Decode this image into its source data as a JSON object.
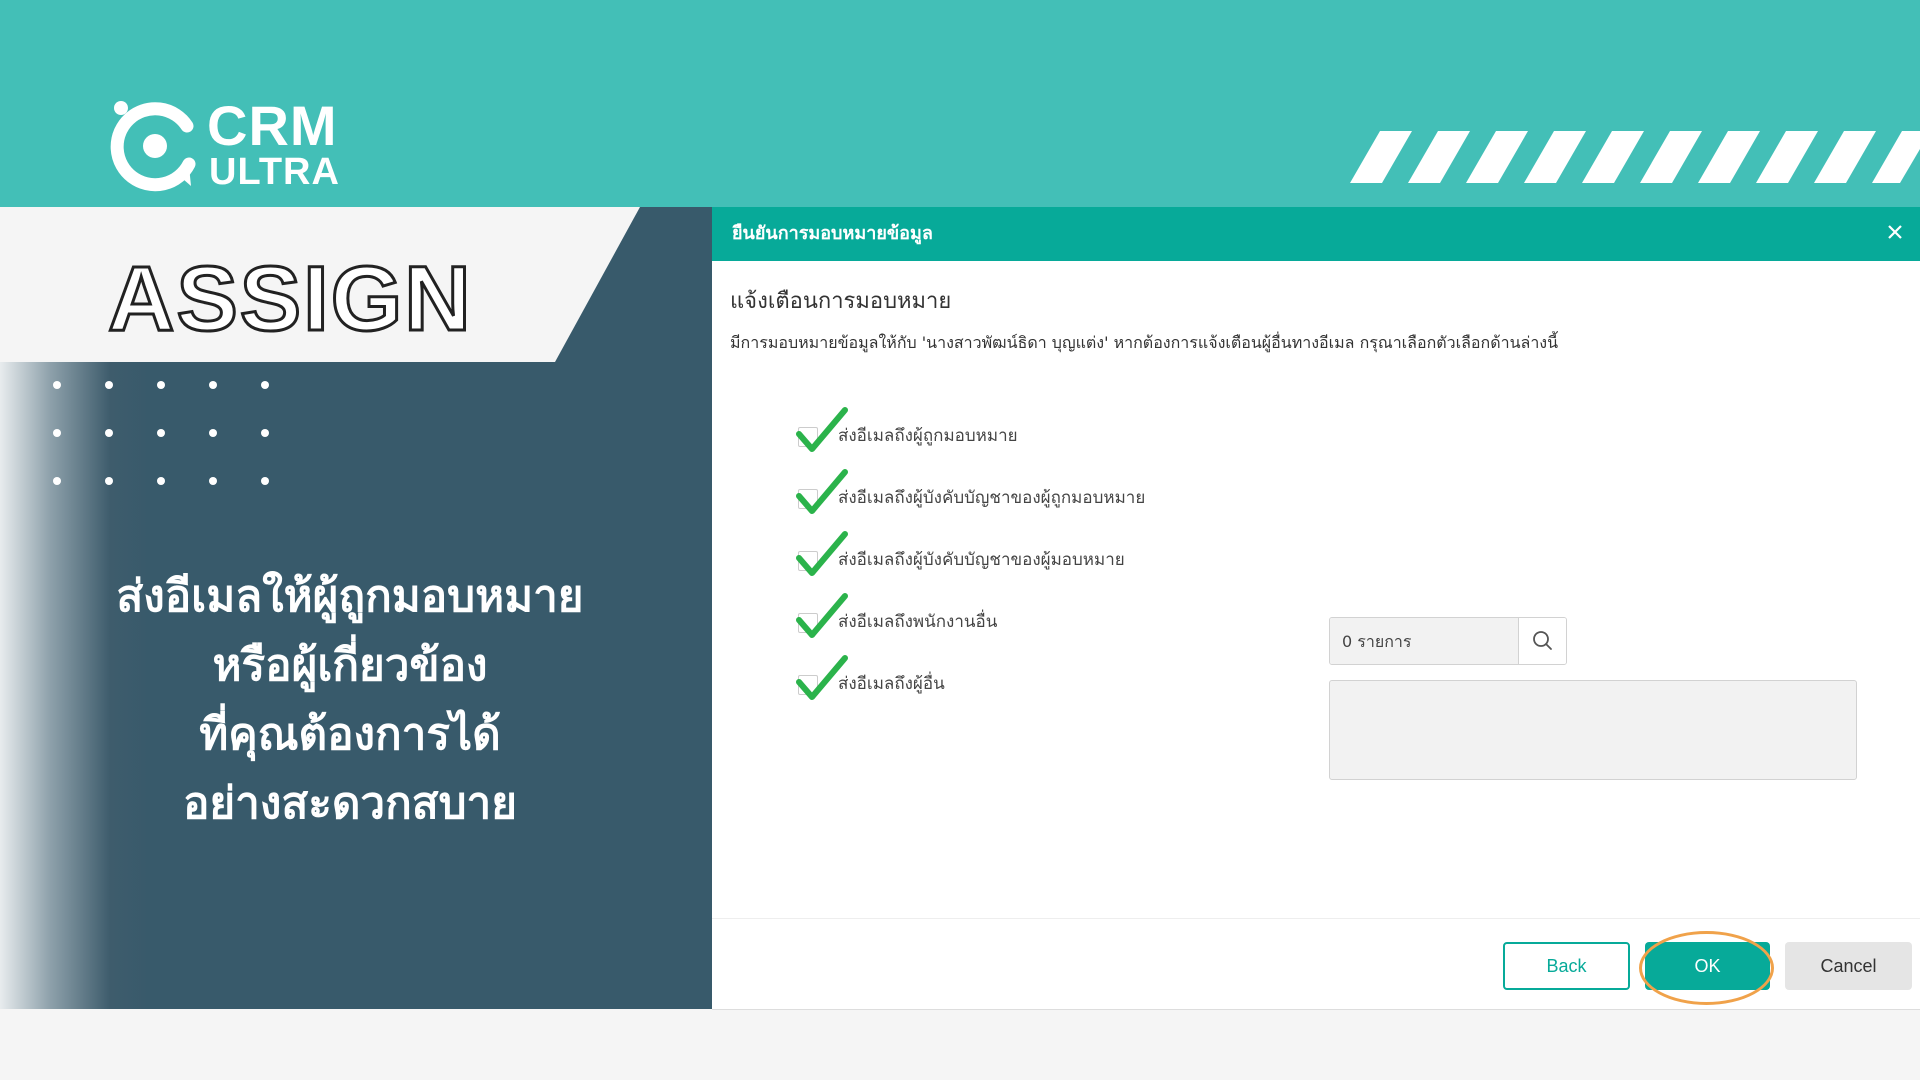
{
  "brand": {
    "name_line1": "CRM",
    "name_line2": "ULTRA"
  },
  "colors": {
    "band_teal": "#43bfb7",
    "dialog_teal": "#07aa99",
    "panel_slate": "#385a6b",
    "check_green": "#2bb34b",
    "highlight_orange": "#f0a24a"
  },
  "promo": {
    "title": "ASSIGN",
    "tagline_lines": [
      "ส่งอีเมลให้ผู้ถูกมอบหมาย",
      "หรือผู้เกี่ยวข้อง",
      "ที่คุณต้องการได้",
      "อย่างสะดวกสบาย"
    ]
  },
  "dialog": {
    "title": "ยืนยันการมอบหมายข้อมูล",
    "close_icon": "close-icon",
    "heading": "แจ้งเตือนการมอบหมาย",
    "message": "มีการมอบหมายข้อมูลให้กับ 'นางสาวพัฒน์ธิดา บุญแต่ง' หากต้องการแจ้งเตือนผู้อื่นทางอีเมล กรุณาเลือกตัวเลือกด้านล่างนี้",
    "options": [
      {
        "label": "ส่งอีเมลถึงผู้ถูกมอบหมาย",
        "checked": true
      },
      {
        "label": "ส่งอีเมลถึงผู้บังคับบัญชาของผู้ถูกมอบหมาย",
        "checked": true
      },
      {
        "label": "ส่งอีเมลถึงผู้บังคับบัญชาของผู้มอบหมาย",
        "checked": true
      },
      {
        "label": "ส่งอีเมลถึงพนักงานอื่น",
        "checked": true
      },
      {
        "label": "ส่งอีเมลถึงผู้อื่น",
        "checked": true
      }
    ],
    "employee_search": {
      "placeholder": "0 รายการ",
      "value": "",
      "icon": "search-icon"
    },
    "buttons": {
      "back": "Back",
      "ok": "OK",
      "cancel": "Cancel"
    }
  }
}
